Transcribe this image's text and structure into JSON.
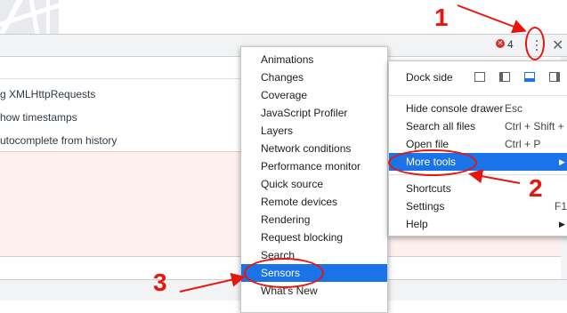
{
  "toolbar": {
    "error_count": "4",
    "error_icon": "✕",
    "more_icon": "kebab-menu-icon",
    "close_icon": "✕"
  },
  "settings": {
    "items": [
      "g XMLHttpRequests",
      "how timestamps",
      "utocomplete from history"
    ]
  },
  "more_tools_submenu": {
    "items": [
      "Animations",
      "Changes",
      "Coverage",
      "JavaScript Profiler",
      "Layers",
      "Network conditions",
      "Performance monitor",
      "Quick source",
      "Remote devices",
      "Rendering",
      "Request blocking",
      "Search",
      "Sensors",
      "What's New"
    ],
    "selected": "Sensors"
  },
  "main_menu": {
    "dock_side_label": "Dock side",
    "items": [
      {
        "label": "Hide console drawer",
        "shortcut": "Esc"
      },
      {
        "label": "Search all files",
        "shortcut": "Ctrl + Shift + F"
      },
      {
        "label": "Open file",
        "shortcut": "Ctrl + P"
      },
      {
        "label": "More tools",
        "shortcut": ""
      },
      {
        "label": "Shortcuts",
        "shortcut": ""
      },
      {
        "label": "Settings",
        "shortcut": "F1"
      },
      {
        "label": "Help",
        "shortcut": ""
      }
    ],
    "selected": "More tools"
  },
  "annotations": {
    "step1": "1",
    "step2": "2",
    "step3": "3"
  },
  "colors": {
    "accent": "#1a73e8",
    "annotation": "#e8150f",
    "error": "#d93025"
  }
}
